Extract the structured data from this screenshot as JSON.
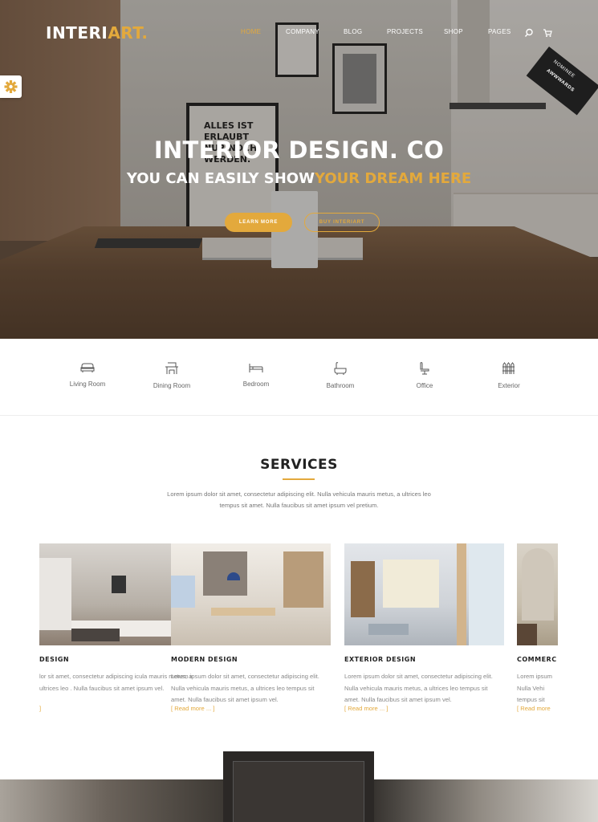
{
  "brand": {
    "logo_main": "INTERI",
    "logo_accent": "ART.",
    "accent_color": "#e3a93c"
  },
  "nav": {
    "items": [
      {
        "label": "HOME",
        "active": true
      },
      {
        "label": "COMPANY",
        "active": false
      },
      {
        "label": "BLOG",
        "active": false
      },
      {
        "label": "PROJECTS",
        "active": false
      },
      {
        "label": "SHOP",
        "active": false
      },
      {
        "label": "PAGES",
        "active": false
      }
    ],
    "icons": [
      "search-icon",
      "cart-icon"
    ]
  },
  "awards": {
    "line1": "NOMINEE",
    "line2": "AWWWARDS"
  },
  "settings_icon": "gear-icon",
  "hero": {
    "title": "INTERIOR DESIGN. CO",
    "subtitle_plain": "YOU CAN EASILY SHOW",
    "subtitle_highlight": "YOUR DREAM HERE",
    "btn_primary": "LEARN MORE",
    "btn_secondary": "BUY INTERIART"
  },
  "poster_text": [
    "ALLES IST",
    "ERLAUBT",
    "NUR NOCH",
    "WERDEN."
  ],
  "categories": [
    {
      "label": "Living Room",
      "icon": "sofa-icon"
    },
    {
      "label": "Dining Room",
      "icon": "dining-icon"
    },
    {
      "label": "Bedroom",
      "icon": "bed-icon"
    },
    {
      "label": "Bathroom",
      "icon": "bathtub-icon"
    },
    {
      "label": "Office",
      "icon": "office-chair-icon"
    },
    {
      "label": "Exterior",
      "icon": "fence-icon"
    }
  ],
  "services": {
    "title": "SERVICES",
    "desc_line1": "Lorem ipsum dolor sit amet, consectetur adipiscing elit. Nulla vehicula mauris metus, a ultrices leo",
    "desc_line2": "tempus sit amet. Nulla faucibus sit amet ipsum vel pretium.",
    "cards": [
      {
        "title": "DESIGN",
        "text": "lor sit amet, consectetur adipiscing icula mauris metus, a ultrices leo . Nulla faucibus sit amet ipsum vel.",
        "more": "]"
      },
      {
        "title": "MODERN DESIGN",
        "text": "Lorem ipsum dolor sit amet, consectetur adipiscing elit. Nulla vehicula mauris metus, a ultrices leo tempus sit amet. Nulla faucibus sit amet ipsum vel.",
        "more": "[ Read more ... ]"
      },
      {
        "title": "EXTERIOR DESIGN",
        "text": "Lorem ipsum dolor sit amet, consectetur adipiscing elit. Nulla vehicula mauris metus, a ultrices leo tempus sit amet. Nulla faucibus sit amet ipsum vel.",
        "more": "[ Read more ... ]"
      },
      {
        "title": "COMMERC",
        "text": "Lorem ipsum Nulla Vehi tempus sit",
        "more": "[ Read more"
      }
    ]
  }
}
